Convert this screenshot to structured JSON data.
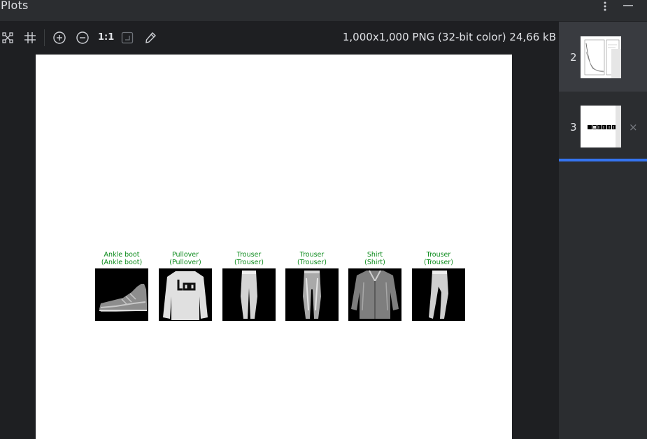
{
  "header": {
    "title": "Plots"
  },
  "toolbar": {
    "actual_size_label": "1:1",
    "image_info": "1,000x1,000 PNG (32-bit color) 24,66 kB"
  },
  "plot": {
    "items": [
      {
        "caption_line1": "Ankle boot",
        "caption_line2": "(Ankle boot)",
        "icon": "ankle-boot-image"
      },
      {
        "caption_line1": "Pullover",
        "caption_line2": "(Pullover)",
        "icon": "pullover-image"
      },
      {
        "caption_line1": "Trouser",
        "caption_line2": "(Trouser)",
        "icon": "trouser-image"
      },
      {
        "caption_line1": "Trouser",
        "caption_line2": "(Trouser)",
        "icon": "trouser-image"
      },
      {
        "caption_line1": "Shirt",
        "caption_line2": "(Shirt)",
        "icon": "shirt-image"
      },
      {
        "caption_line1": "Trouser",
        "caption_line2": "(Trouser)",
        "icon": "trouser-image"
      }
    ],
    "caption_color": "#0a8a1a"
  },
  "sidebar": {
    "entries": [
      {
        "number": "2",
        "selected": true
      },
      {
        "number": "3",
        "selected": false,
        "close": "×"
      }
    ],
    "accent_color": "#3574f0"
  }
}
